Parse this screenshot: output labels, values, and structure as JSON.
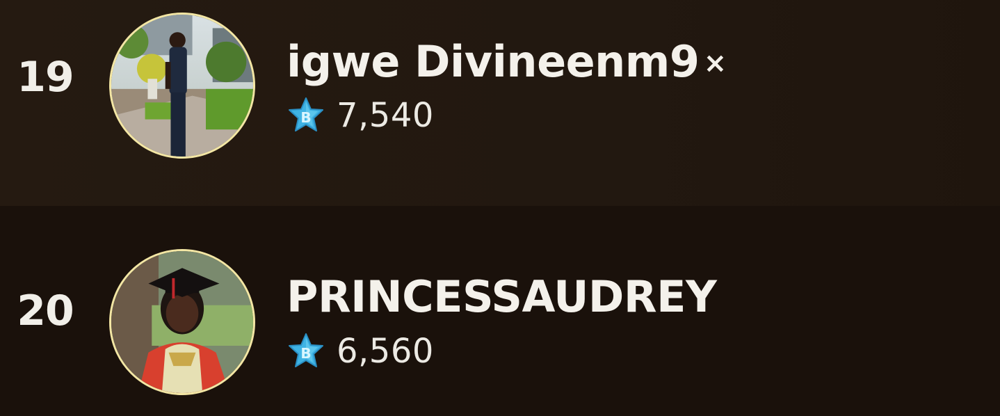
{
  "leaderboard": {
    "entries": [
      {
        "rank": "19",
        "name": "igwe Divineenm9",
        "name_mark": "×",
        "score": "7,540",
        "badge_icon": "blue-star-b-icon",
        "avatar": "man-standing-outdoors-photo"
      },
      {
        "rank": "20",
        "name": "PRINCESSAUDREY",
        "score": "6,560",
        "badge_icon": "blue-star-b-icon",
        "avatar": "woman-graduation-cap-photo"
      }
    ]
  },
  "colors": {
    "background": "#1a110b",
    "highlight_row": "#241910",
    "avatar_ring": "#f3e6a4",
    "badge_blue": "#3fb3e4",
    "text": "#f4f1eb"
  }
}
